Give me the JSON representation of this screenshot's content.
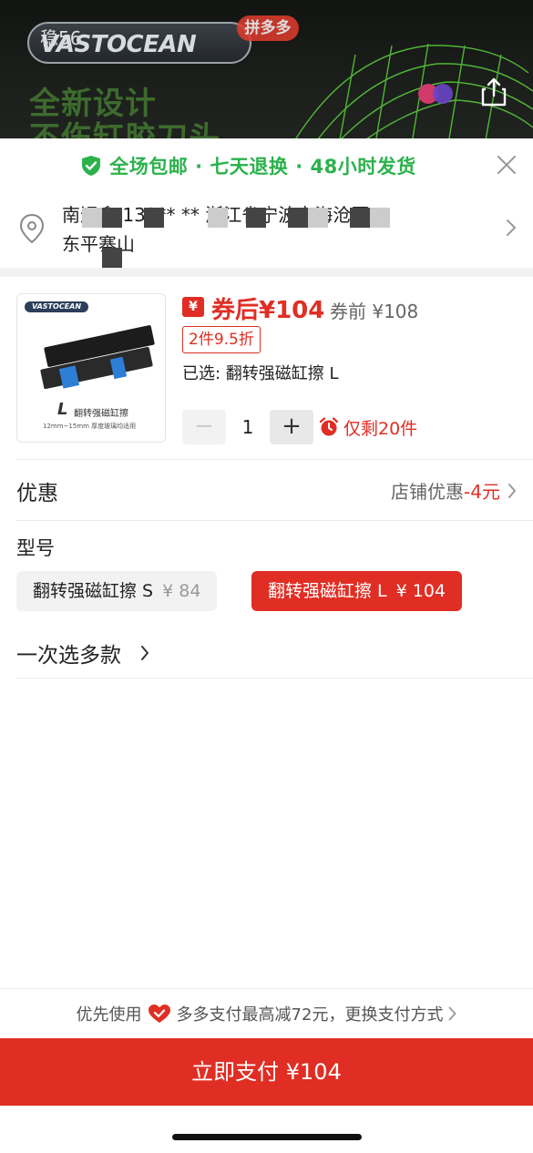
{
  "hero": {
    "number": "稳56",
    "logo_text": "VASTOCEAN",
    "badge": "拼多多",
    "line1": "全新设计",
    "line2": "不伤缸胶刀头"
  },
  "banner": {
    "text": "全场包邮 · 七天退换 · 48小时发货"
  },
  "address": {
    "line1": "南迟鑫 138** ** 浙江省宁波市海沧区",
    "line2": "东平寨山"
  },
  "product": {
    "thumb_logo": "VASTOCEAN",
    "thumb_letter": "L",
    "thumb_name": "翻转强磁缸擦",
    "thumb_spec": "12mm~15mm 厚度玻璃均适用",
    "coupon_icon": "¥",
    "price_after": "券后¥104",
    "price_before": "券前 ¥108",
    "discount_tag": "2件9.5折",
    "selected": "已选: 翻转强磁缸擦 L",
    "quantity": "1",
    "minus": "−",
    "plus": "+",
    "stock": "仅剩20件"
  },
  "promo": {
    "label": "优惠",
    "value_prefix": "店铺优惠",
    "value_amount": "-4元"
  },
  "model": {
    "label": "型号",
    "options": [
      {
        "name": "翻转强磁缸擦 S",
        "price": "¥ 84",
        "selected": false
      },
      {
        "name": "翻转强磁缸擦 L",
        "price": "¥ 104",
        "selected": true
      }
    ]
  },
  "multi_select": "一次选多款",
  "pay": {
    "hint_prefix": "优先使用",
    "hint_suffix": "多多支付最高减72元，更换支付方式",
    "button": "立即支付 ¥104"
  },
  "colors": {
    "brand_red": "#e02e24",
    "green": "#2bb24c"
  }
}
